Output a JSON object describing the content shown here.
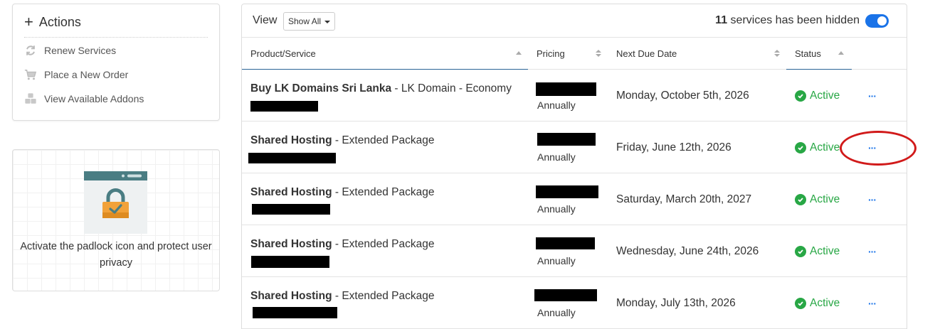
{
  "actions": {
    "title": "Actions",
    "items": [
      {
        "label": "Renew Services",
        "icon": "refresh-icon"
      },
      {
        "label": "Place a New Order",
        "icon": "cart-icon"
      },
      {
        "label": "View Available Addons",
        "icon": "cubes-icon"
      }
    ]
  },
  "privacy": {
    "text": "Activate the padlock icon and protect user privacy",
    "icon": "padlock-illustration"
  },
  "toolbar": {
    "view_label": "View",
    "view_select": "Show All",
    "hidden_count": "11",
    "hidden_text": "services has been hidden"
  },
  "table": {
    "headers": [
      "Product/Service",
      "Pricing",
      "Next Due Date",
      "Status"
    ],
    "rows": [
      {
        "product_bold": "Buy LK Domains Sri Lanka",
        "product_rest": " - LK Domain - Economy",
        "cycle": "Annually",
        "due": "Monday, October 5th, 2026",
        "status": "Active"
      },
      {
        "product_bold": "Shared Hosting",
        "product_rest": " - Extended Package",
        "cycle": "Annually",
        "due": "Friday, June 12th, 2026",
        "status": "Active"
      },
      {
        "product_bold": "Shared Hosting",
        "product_rest": " - Extended Package",
        "cycle": "Annually",
        "due": "Saturday, March 20th, 2027",
        "status": "Active"
      },
      {
        "product_bold": "Shared Hosting",
        "product_rest": " - Extended Package",
        "cycle": "Annually",
        "due": "Wednesday, June 24th, 2026",
        "status": "Active"
      },
      {
        "product_bold": "Shared Hosting",
        "product_rest": " - Extended Package",
        "cycle": "Annually",
        "due": "Monday, July 13th, 2026",
        "status": "Active"
      }
    ],
    "more_label": "···"
  },
  "colors": {
    "accent": "#1a73e8",
    "active": "#28a745",
    "annotation": "#d11a1a"
  }
}
